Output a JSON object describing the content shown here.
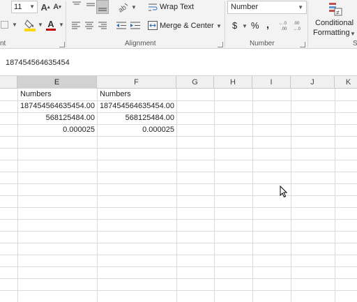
{
  "ribbon": {
    "font_size": "11",
    "wrap_text_label": "Wrap Text",
    "merge_center_label": "Merge & Center",
    "number_format": "Number",
    "currency_symbol": "$",
    "percent_symbol": "%",
    "comma_symbol": ",",
    "conditional_label_1": "Conditional",
    "conditional_label_2": "Formatting",
    "group_font_tail": "nt",
    "group_alignment": "Alignment",
    "group_number": "Number",
    "group_styles_tail": "S",
    "icons": {
      "font_color": "A",
      "font_color_bar": "#c00000",
      "fill_color_bar": "#ffd700"
    }
  },
  "formula_bar": {
    "value": "187454564635454"
  },
  "sheet": {
    "columns": [
      "E",
      "F",
      "G",
      "H",
      "I",
      "J",
      "K"
    ],
    "selected_column": "E",
    "rows": [
      {
        "e": "Numbers",
        "f": "Numbers"
      },
      {
        "e": "187454564635454.00",
        "f": "187454564635454.00"
      },
      {
        "e": "568125484.00",
        "f": "568125484.00"
      },
      {
        "e": "0.000025",
        "f": "0.000025"
      }
    ]
  }
}
